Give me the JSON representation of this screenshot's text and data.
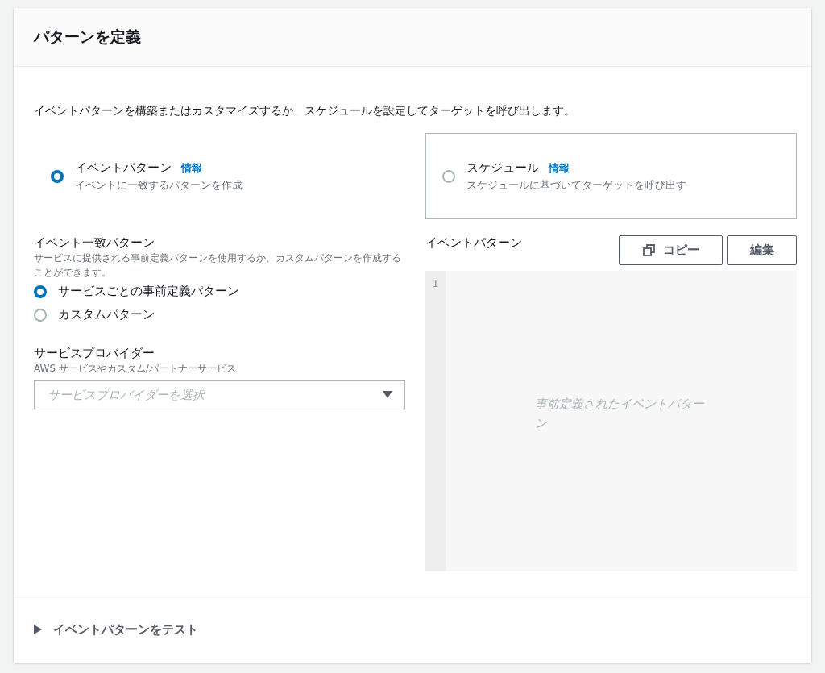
{
  "panel": {
    "title": "パターンを定義",
    "description": "イベントパターンを構築またはカスタマイズするか、スケジュールを設定してターゲットを呼び出します。"
  },
  "rule_types": [
    {
      "label": "イベントパターン",
      "info": "情報",
      "description": "イベントに一致するパターンを作成",
      "selected": true
    },
    {
      "label": "スケジュール",
      "info": "情報",
      "description": "スケジュールに基づいてターゲットを呼び出す",
      "selected": false
    }
  ],
  "match_pattern": {
    "label": "イベント一致パターン",
    "description": "サービスに提供される事前定義パターンを使用するか、カスタムパターンを作成することができます。",
    "options": [
      {
        "label": "サービスごとの事前定義パターン",
        "selected": true
      },
      {
        "label": "カスタムパターン",
        "selected": false
      }
    ]
  },
  "service_provider": {
    "label": "サービスプロバイダー",
    "description": "AWS サービスやカスタム/パートナーサービス",
    "placeholder": "サービスプロバイダーを選択"
  },
  "editor": {
    "label": "イベントパターン",
    "buttons": [
      {
        "kind": "copy",
        "label": "コピー"
      },
      {
        "kind": "plain",
        "label": "編集"
      }
    ],
    "line_numbers": [
      "1"
    ],
    "placeholder": "事前定義されたイベントパターン"
  },
  "test_section": {
    "label": "イベントパターンをテスト",
    "expanded": false
  }
}
